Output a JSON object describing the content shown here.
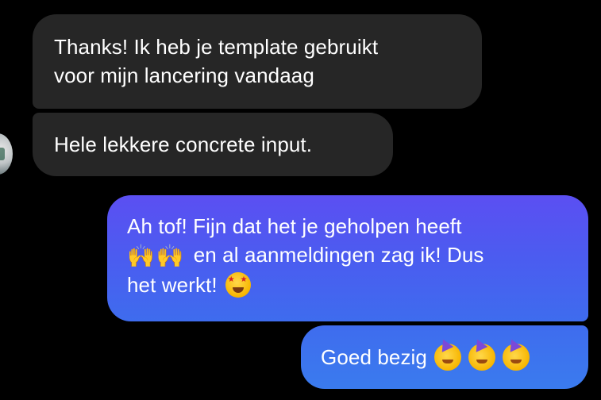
{
  "conversation": {
    "incoming": [
      {
        "lines": [
          "Thanks! Ik heb je template gebruikt",
          "voor mijn lancering vandaag"
        ]
      },
      {
        "lines": [
          "Hele lekkere concrete input."
        ]
      }
    ],
    "outgoing": [
      {
        "line1": "Ah tof! Fijn dat het je geholpen heeft",
        "hands_emoji": "🙌🙌",
        "line2_text": "en al aanmeldingen zag ik! Dus",
        "line3_text": "het werkt!",
        "line3_emoji": "star-struck-emoji"
      },
      {
        "text": "Goed bezig",
        "emojis": [
          "partying-face-emoji",
          "partying-face-emoji",
          "partying-face-emoji"
        ]
      }
    ]
  },
  "colors": {
    "background": "#000000",
    "incoming_bubble": "#262626",
    "outgoing_gradient_top": "#5a4ff0",
    "outgoing_gradient_bottom": "#3f72ee",
    "text": "#ffffff"
  },
  "avatar": {
    "icon": "contact-avatar"
  }
}
